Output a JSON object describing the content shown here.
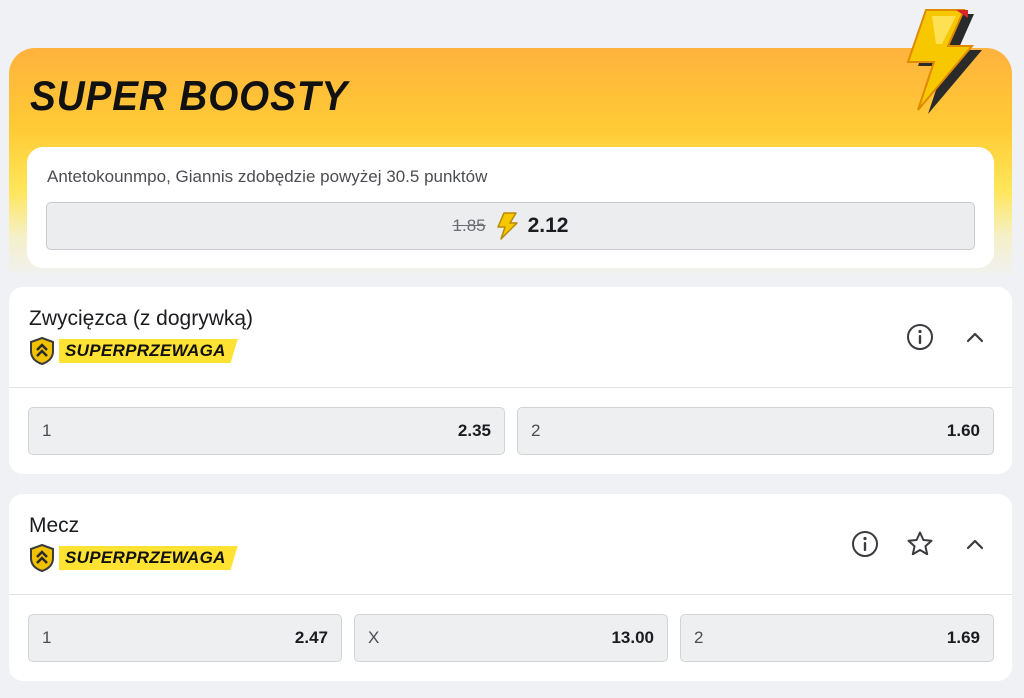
{
  "boost": {
    "title": "SUPER BOOSTY",
    "description": "Antetokounmpo, Giannis zdobędzie powyżej 30.5 punktów",
    "old_odds": "1.85",
    "new_odds": "2.12"
  },
  "markets": [
    {
      "title": "Zwycięzca (z dogrywką)",
      "badge": "SUPERPRZEWAGA",
      "icons": [
        "info-icon",
        "chevron-up-icon"
      ],
      "outcomes": [
        {
          "label": "1",
          "odds": "2.35"
        },
        {
          "label": "2",
          "odds": "1.60"
        }
      ]
    },
    {
      "title": "Mecz",
      "badge": "SUPERPRZEWAGA",
      "icons": [
        "info-icon",
        "star-icon",
        "chevron-up-icon"
      ],
      "outcomes": [
        {
          "label": "1",
          "odds": "2.47"
        },
        {
          "label": "X",
          "odds": "13.00"
        },
        {
          "label": "2",
          "odds": "1.69"
        }
      ]
    }
  ],
  "colors": {
    "accent_yellow": "#ffe232",
    "bolt_yellow": "#f7c800",
    "background": "#f0f1f4"
  }
}
